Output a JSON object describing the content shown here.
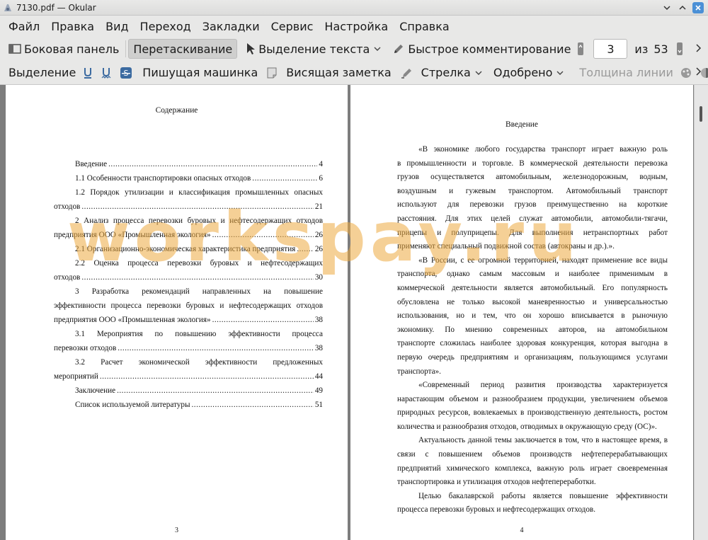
{
  "window": {
    "title": "7130.pdf  — Okular"
  },
  "menu": [
    "Файл",
    "Правка",
    "Вид",
    "Переход",
    "Закладки",
    "Сервис",
    "Настройка",
    "Справка"
  ],
  "toolbar1": {
    "sidebar": "Боковая панель",
    "drag": "Перетаскивание",
    "text_select": "Выделение текста",
    "quick_comment": "Быстрое комментирование",
    "page_current": "3",
    "of_label": "из",
    "page_total": "53"
  },
  "toolbar2": {
    "highlight": "Выделение",
    "typewriter": "Пишущая машинка",
    "sticky_note": "Висящая заметка",
    "arrow": "Стрелка",
    "stamp": "Одобрено",
    "line_width": "Толщина линии"
  },
  "left_page": {
    "heading": "Содержание",
    "toc": [
      {
        "text": "Введение",
        "page": "4",
        "indent": true
      },
      {
        "text": "1.1 Особенности транспортировки опасных отходов",
        "page": "6",
        "indent": true
      },
      {
        "text": "1.2 Порядок утилизации и классификация промышленных опасных",
        "indent": true,
        "plain": true
      },
      {
        "text": "отходов",
        "page": "21"
      },
      {
        "text": "2 Анализ процесса перевозки буровых и нефтесодержащих отходов",
        "indent": true,
        "plain": true
      },
      {
        "text": "предприятия ООО «Промышленная экология»",
        "page": "26"
      },
      {
        "text": "2.1 Организационно-экономическая характеристика предприятия",
        "page": "26",
        "indent": true
      },
      {
        "text": "2.2 Оценка процесса перевозки буровых и нефтесодержащих",
        "indent": true,
        "plain": true
      },
      {
        "text": "отходов",
        "page": "30"
      },
      {
        "text": "3 Разработка рекомендаций направленных на повышение",
        "indent": true,
        "plain": true
      },
      {
        "text": "эффективности процесса перевозки буровых и нефтесодержащих отходов",
        "plain": true
      },
      {
        "text": "предприятия ООО «Промышленная экология»",
        "page": "38"
      },
      {
        "text": "3.1 Мероприятия по повышению эффективности процесса",
        "indent": true,
        "plain": true
      },
      {
        "text": "перевозки отходов",
        "page": "38"
      },
      {
        "text": "3.2 Расчет экономической эффективности предложенных",
        "indent": true,
        "plain": true
      },
      {
        "text": "мероприятий",
        "page": "44"
      },
      {
        "text": "Заключение",
        "page": "49",
        "indent": true
      },
      {
        "text": "Список используемой литературы",
        "page": "51",
        "indent": true
      }
    ],
    "page_number": "3"
  },
  "right_page": {
    "heading": "Введение",
    "lines": [
      {
        "t": "«В экономике любого государства транспорт играет важную роль",
        "first": true
      },
      {
        "t": "в промышленности и торговле. В коммерческой деятельности перевозка"
      },
      {
        "t": "грузов осуществляется автомобильным, железнодорожным, водным,"
      },
      {
        "t": "воздушным и гужевым транспортом. Автомобильный транспорт"
      },
      {
        "t": "используют для перевозки грузов преимущественно на короткие"
      },
      {
        "t": "расстояния. Для этих целей служат автомобили, автомобили-тягачи,"
      },
      {
        "t": "прицепы и полуприцепы. Для выполнения нетранспортных работ"
      },
      {
        "t": "применяют специальный подвижной состав (автокраны и др.).».",
        "last": true
      },
      {
        "t": "«В России, с ее огромной территорией, находят применение все виды",
        "first": true
      },
      {
        "t": "транспорта, однако самым массовым и наиболее применимым в"
      },
      {
        "t": "коммерческой деятельности является автомобильный. Его популярность"
      },
      {
        "t": "обусловлена не только высокой маневренностью и универсальностью"
      },
      {
        "t": "использования, но и тем, что он хорошо вписывается в рыночную"
      },
      {
        "t": "экономику. По мнению современных авторов, на автомобильном"
      },
      {
        "t": "транспорте сложилась наиболее здоровая конкуренция, которая выгодна в"
      },
      {
        "t": "первую очередь предприятиям и организациям, пользующимся услугами"
      },
      {
        "t": "транспорта».",
        "last": true
      },
      {
        "t": "«Современный период развития производства характеризуется",
        "first": true
      },
      {
        "t": "нарастающим объемом и разнообразием продукции, увеличением объемов"
      },
      {
        "t": "природных ресурсов, вовлекаемых в производственную деятельность, ростом"
      },
      {
        "t": "количества и разнообразия отходов, отводимых в окружающую среду (ОС)».",
        "last": true
      },
      {
        "t": "Актуальность данной темы заключается в том, что в настоящее время, в",
        "first": true
      },
      {
        "t": "связи с повышением объемов производств нефтеперерабатывающих"
      },
      {
        "t": "предприятий химического комплекса, важную роль играет своевременная"
      },
      {
        "t": "транспортировка и утилизация отходов нефтепереработки.",
        "last": true
      },
      {
        "t": "Целью бакалаврской работы является повышение эффективности",
        "first": true
      },
      {
        "t": "процесса перевозки буровых и нефтесодержащих отходов.",
        "last": true
      }
    ],
    "page_number": "4"
  },
  "watermark": "workspay.ru",
  "colors": {
    "accent": "#4b90d6",
    "watermark": "#ecaa40",
    "doc_bg": "#7d7d7d"
  }
}
